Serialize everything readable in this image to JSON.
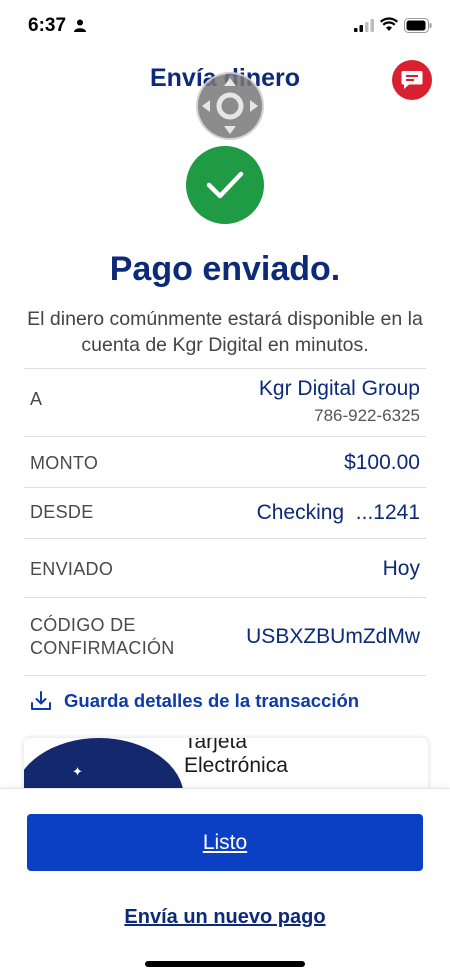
{
  "status_bar": {
    "time": "6:37"
  },
  "header": {
    "title": "Envía dinero"
  },
  "confirmation": {
    "headline": "Pago enviado.",
    "message": "El dinero comúnmente estará disponible en la cuenta de Kgr Digital en minutos."
  },
  "details": {
    "to_label": "A",
    "to_name": "Kgr Digital Group",
    "to_phone": "786-922-6325",
    "amount_label": "MONTO",
    "amount_value": "$100.00",
    "from_label": "DESDE",
    "from_value": "Checking  ...1241",
    "sent_label": "ENVIADO",
    "sent_value": "Hoy",
    "code_label_1": "CÓDIGO DE",
    "code_label_2": "CONFIRMACIÓN",
    "code_value": "USBXZBUmZdMw"
  },
  "save_link": {
    "label": "Guarda detalles de la transacción"
  },
  "promo": {
    "line1": "Tarjeta",
    "line2": "Electrónica"
  },
  "actions": {
    "done_label": "Listo",
    "new_payment_label": "Envía un nuevo pago"
  },
  "colors": {
    "brand_navy": "#0d2a78",
    "primary_button": "#0b3fc4",
    "success_green": "#1f9a45",
    "chat_red": "#d8202e"
  }
}
